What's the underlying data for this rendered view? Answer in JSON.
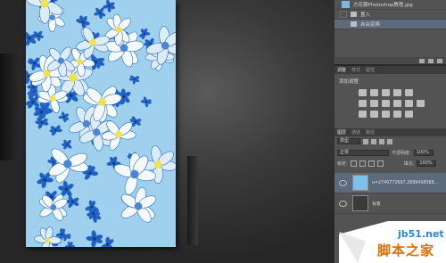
{
  "history_panel": {
    "top_item": "方花瓣Photoshop教程.jpg",
    "items": [
      {
        "label": "置入"
      },
      {
        "label": "自由变换"
      }
    ]
  },
  "adjustments_panel": {
    "tabs": [
      "调整",
      "样式",
      "属性"
    ],
    "title": "添加调整"
  },
  "layers_panel": {
    "tabs": [
      "图层",
      "通道",
      "路径"
    ],
    "kind_filter": "类型",
    "blend_mode": "正常",
    "opacity_label": "不透明度:",
    "opacity_value": "100%",
    "lock_label": "锁定:",
    "fill_label": "填充:",
    "fill_value": "100%",
    "layers": [
      {
        "name": "u=2740772697,2899408588...",
        "selected": true
      },
      {
        "name": "背景",
        "selected": false
      }
    ]
  },
  "watermark": {
    "site": "jb51.net",
    "text": "脚本之家"
  },
  "colors": {
    "panel_bg": "#535353",
    "selection": "#5c6a7b",
    "watermark_blue": "#2b86d6",
    "watermark_orange": "#e06d00"
  }
}
